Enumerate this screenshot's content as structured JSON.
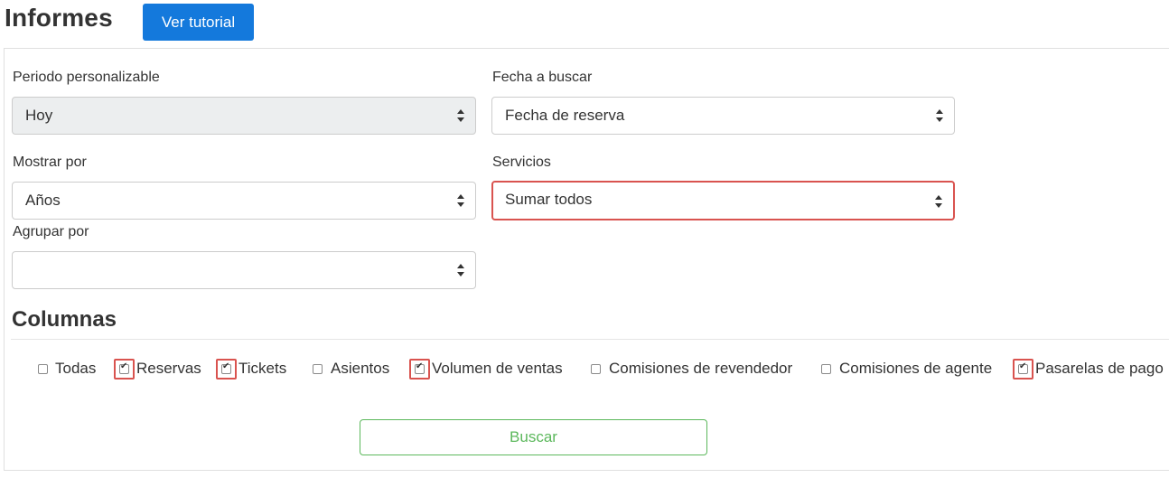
{
  "header": {
    "title": "Informes",
    "tutorial_button": "Ver tutorial"
  },
  "filters": {
    "periodo": {
      "label": "Periodo personalizable",
      "value": "Hoy"
    },
    "fecha": {
      "label": "Fecha a buscar",
      "value": "Fecha de reserva"
    },
    "mostrar": {
      "label": "Mostrar por",
      "value": "Años"
    },
    "servicios": {
      "label": "Servicios",
      "value": "Sumar todos"
    },
    "agrupar": {
      "label": "Agrupar por",
      "value": ""
    }
  },
  "columns": {
    "title": "Columnas",
    "items": [
      {
        "label": "Todas",
        "checked": false
      },
      {
        "label": "Reservas",
        "checked": true
      },
      {
        "label": "Tickets",
        "checked": true
      },
      {
        "label": "Asientos",
        "checked": false
      },
      {
        "label": "Volumen de ventas",
        "checked": true
      },
      {
        "label": "Comisiones de revendedor",
        "checked": false
      },
      {
        "label": "Comisiones de agente",
        "checked": false
      },
      {
        "label": "Pasarelas de pago",
        "checked": true
      }
    ]
  },
  "actions": {
    "search": "Buscar"
  },
  "colors": {
    "primary": "#1479dc",
    "success": "#5cb85c",
    "highlight": "#d9534f"
  }
}
